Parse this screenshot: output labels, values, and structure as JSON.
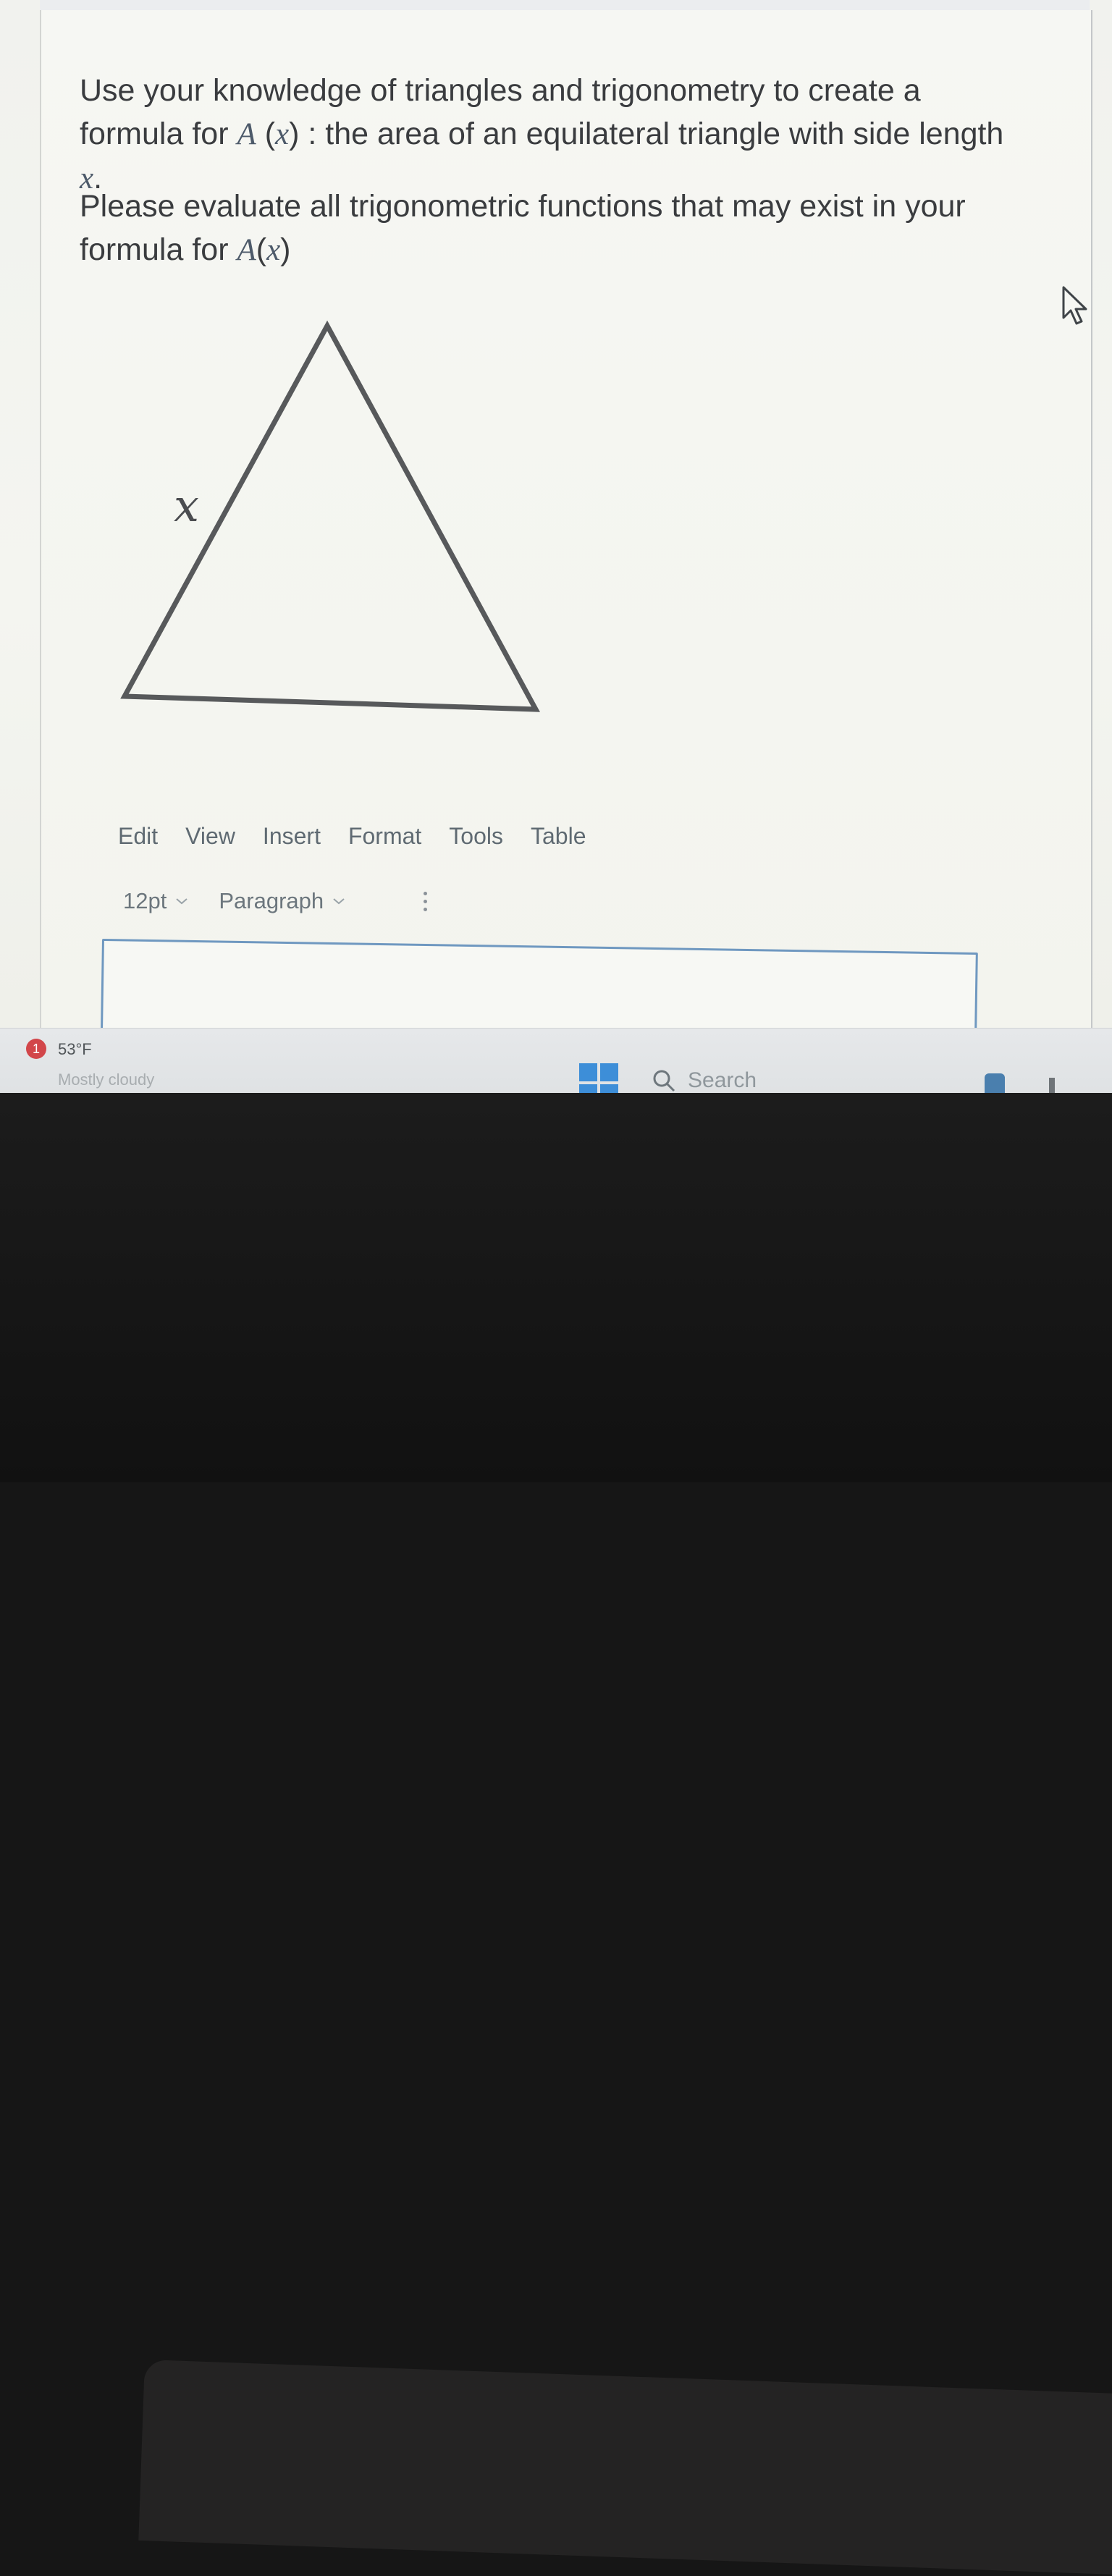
{
  "question": {
    "line1_prefix": "Use your knowledge of triangles and trigonometry to create a formula for ",
    "line1_func": "A",
    "line1_open": " (",
    "line1_var": "x",
    "line1_close": ")",
    "line1_suffix": " : the area of an equilateral triangle with side length ",
    "line1_var2": "x",
    "line1_end": ".",
    "line2_prefix": "Please evaluate all trigonometric functions that may exist in your formula for ",
    "line2_func": "A",
    "line2_open": "(",
    "line2_var": "x",
    "line2_close": ")"
  },
  "triangle": {
    "side_label": "x",
    "shape": "equilateral triangle"
  },
  "editor": {
    "menu": [
      "Edit",
      "View",
      "Insert",
      "Format",
      "Tools",
      "Table"
    ],
    "font_size": "12pt",
    "block_format": "Paragraph"
  },
  "taskbar": {
    "notification_count": "1",
    "weather_temp": "53°F",
    "weather_condition": "Mostly cloudy",
    "search_label": "Search"
  },
  "colors": {
    "editor_border": "#6f98c0",
    "start_button": "#3d8ed8",
    "notification_badge": "#d2464a"
  },
  "icons": [
    "mouse-pointer-icon",
    "windows-start-icon",
    "search-icon",
    "chevron-down-icon",
    "more-options-icon"
  ]
}
